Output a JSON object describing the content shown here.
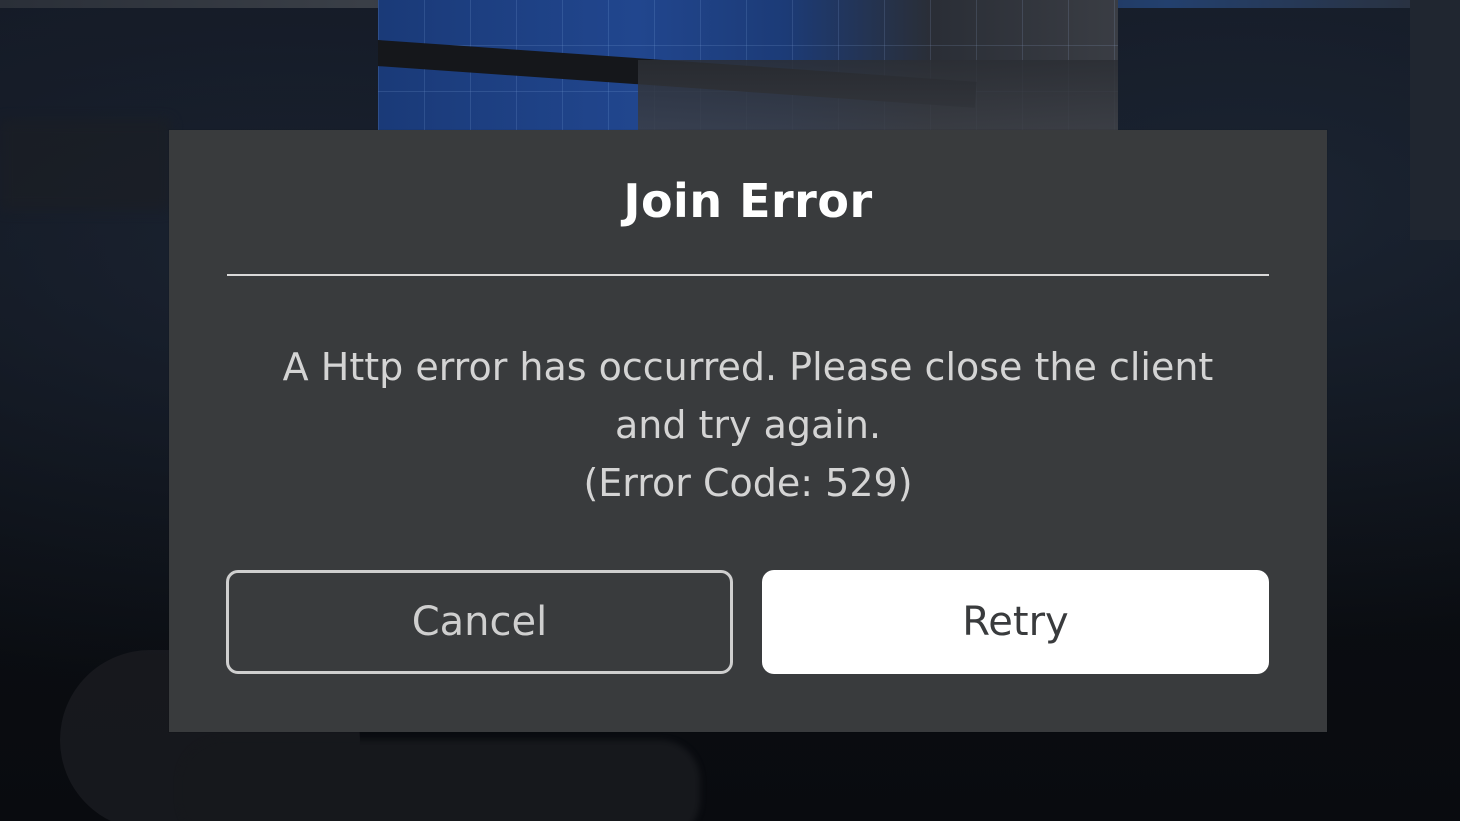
{
  "dialog": {
    "title": "Join Error",
    "message_line1": "A Http error has occurred. Please close the client",
    "message_line2": "and try again.",
    "error_code": "(Error Code: 529)",
    "cancel_label": "Cancel",
    "retry_label": "Retry"
  },
  "colors": {
    "dialog_bg": "#393b3d",
    "retry_bg": "#ffffff",
    "text_primary": "#ffffff",
    "text_secondary": "#d4d4d4"
  }
}
